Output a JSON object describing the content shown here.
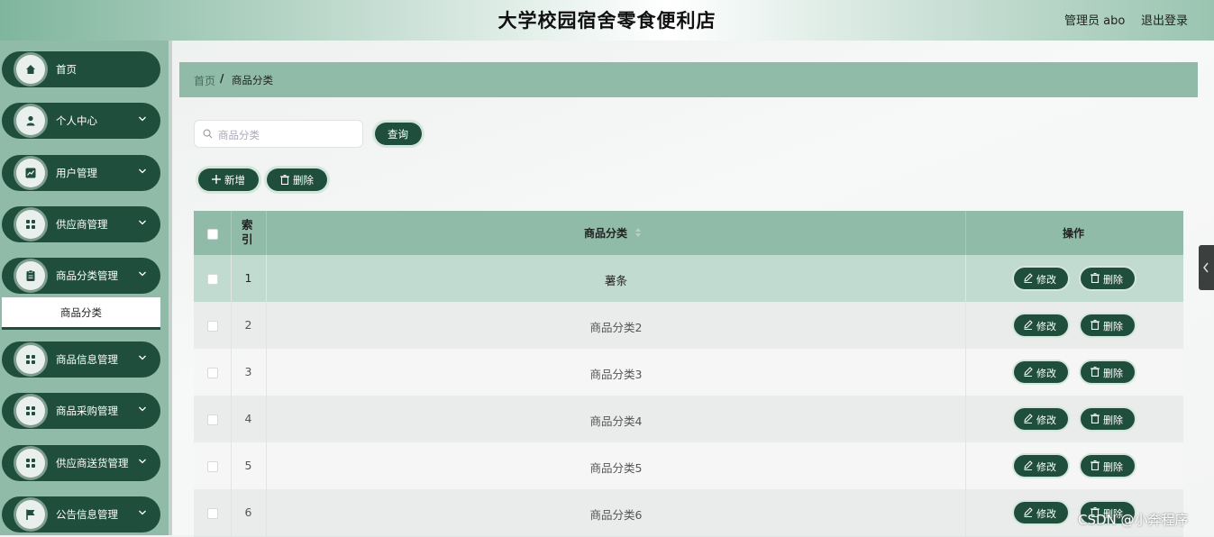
{
  "header": {
    "title": "大学校园宿舍零食便利店",
    "admin": "管理员 abo",
    "logout": "退出登录"
  },
  "sidebar": {
    "items": [
      {
        "label": "首页",
        "icon": "home-icon"
      },
      {
        "label": "个人中心",
        "icon": "user-icon"
      },
      {
        "label": "用户管理",
        "icon": "chart-icon"
      },
      {
        "label": "供应商管理",
        "icon": "grid-icon"
      },
      {
        "label": "商品分类管理",
        "icon": "clipboard-icon"
      },
      {
        "label": "商品信息管理",
        "icon": "grid-icon"
      },
      {
        "label": "商品采购管理",
        "icon": "grid-icon"
      },
      {
        "label": "供应商送货管理",
        "icon": "grid-icon"
      },
      {
        "label": "公告信息管理",
        "icon": "flag-icon"
      }
    ],
    "submenu": "商品分类"
  },
  "breadcrumb": {
    "home": "首页",
    "sep": "/",
    "current": "商品分类"
  },
  "search": {
    "placeholder": "商品分类",
    "button": "查询"
  },
  "toolbar": {
    "add": "新增",
    "delete": "删除"
  },
  "table": {
    "headers": {
      "index": "索引",
      "category": "商品分类",
      "actions": "操作"
    },
    "rows": [
      {
        "index": "1",
        "category": "薯条"
      },
      {
        "index": "2",
        "category": "商品分类2"
      },
      {
        "index": "3",
        "category": "商品分类3"
      },
      {
        "index": "4",
        "category": "商品分类4"
      },
      {
        "index": "5",
        "category": "商品分类5"
      },
      {
        "index": "6",
        "category": "商品分类6"
      }
    ],
    "edit_label": "修改",
    "delete_label": "删除"
  },
  "watermark": "CSDN @小奔程序",
  "colors": {
    "accent": "#1f4e3d",
    "header_bg": "#8fbba8",
    "row_highlight": "#c2dbd0"
  }
}
